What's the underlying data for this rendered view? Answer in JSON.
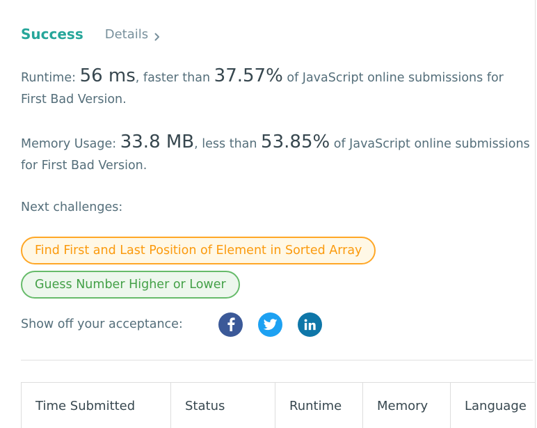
{
  "result": {
    "status": "Success",
    "details_link": "Details"
  },
  "runtime": {
    "label": "Runtime: ",
    "value": "56 ms",
    "middle": ", faster than ",
    "percent": "37.57%",
    "suffix": " of JavaScript online submissions for First Bad Version."
  },
  "memory": {
    "label": "Memory Usage: ",
    "value": "33.8 MB",
    "middle": ", less than ",
    "percent": "53.85%",
    "suffix": " of JavaScript online submissions for First Bad Version."
  },
  "next_challenges": {
    "label": "Next challenges:",
    "items": [
      {
        "title": "Find First and Last Position of Element in Sorted Array",
        "difficulty_color": "#ffa726"
      },
      {
        "title": "Guess Number Higher or Lower",
        "difficulty_color": "#66bb6a"
      }
    ]
  },
  "share": {
    "label": "Show off your acceptance:",
    "icons": [
      "facebook-icon",
      "twitter-icon",
      "linkedin-icon"
    ],
    "colors": {
      "facebook": "#3b5998",
      "twitter": "#1da1f2",
      "linkedin": "#0e76a8"
    }
  },
  "submissions_table": {
    "headers": [
      "Time Submitted",
      "Status",
      "Runtime",
      "Memory",
      "Language"
    ]
  },
  "colors": {
    "success": "#26a69a",
    "text": "#546e7a"
  }
}
